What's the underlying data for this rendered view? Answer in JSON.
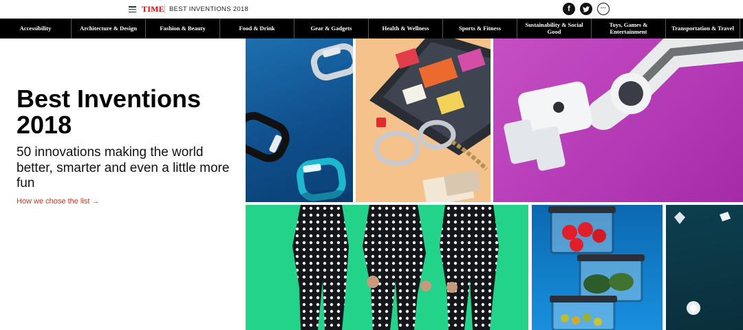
{
  "header": {
    "brand": "TIME",
    "section_title": "BEST INVENTIONS 2018",
    "menu_icon": "hamburger-menu-icon",
    "social": [
      {
        "icon": "facebook-icon",
        "glyph": "f"
      },
      {
        "icon": "twitter-icon",
        "glyph": "t"
      },
      {
        "icon": "more-icon",
        "glyph": "···"
      }
    ]
  },
  "nav": {
    "items": [
      {
        "label": "Accessibility"
      },
      {
        "label": "Architecture & Design"
      },
      {
        "label": "Fashion & Beauty"
      },
      {
        "label": "Food & Drink"
      },
      {
        "label": "Gear & Gadgets"
      },
      {
        "label": "Health & Wellness"
      },
      {
        "label": "Sports & Fitness"
      },
      {
        "label": "Sustainability & Social Good"
      },
      {
        "label": "Toys, Games & Entertainment"
      },
      {
        "label": "Transportation & Travel"
      }
    ]
  },
  "hero": {
    "title": "Best Inventions 2018",
    "subtitle": "50 innovations making the world better, smarter and even a little more fun",
    "link": "How we chose the list →"
  },
  "tiles": [
    {
      "name": "fitness-trackers-image"
    },
    {
      "name": "board-game-image"
    },
    {
      "name": "robot-arm-image"
    },
    {
      "name": "polka-dot-bodysuit-image"
    },
    {
      "name": "food-containers-image"
    },
    {
      "name": "diamonds-image"
    }
  ],
  "colors": {
    "brand_red": "#e90606",
    "nav_bg": "#000000",
    "link_red": "#c0392b"
  }
}
